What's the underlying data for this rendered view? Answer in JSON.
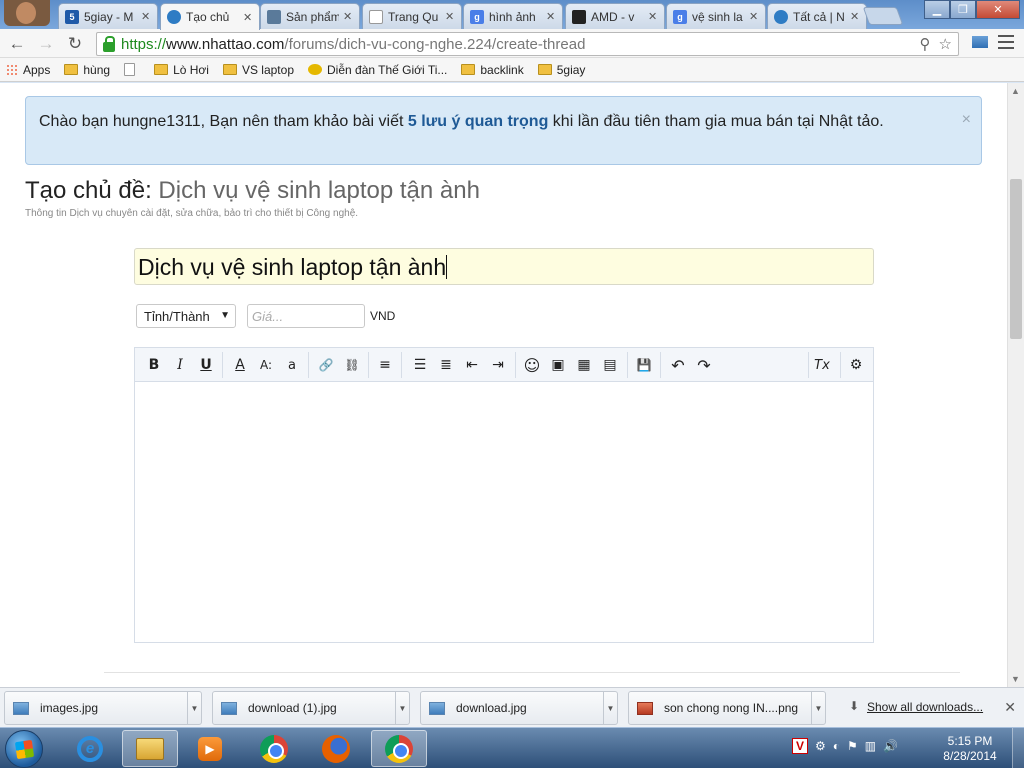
{
  "browser": {
    "tabs": [
      {
        "label": "5giay - M",
        "favicon_text": "5",
        "favicon_color": "#1f5aa8"
      },
      {
        "label": "Tạo chủ",
        "favicon_text": "",
        "favicon_color": "#2e7cc4"
      },
      {
        "label": "Sản phẩm",
        "favicon_text": "",
        "favicon_color": "#5a7a9a"
      },
      {
        "label": "Trang Qu",
        "favicon_text": "",
        "favicon_color": "#ffffff"
      },
      {
        "label": "hình ảnh",
        "favicon_text": "g",
        "favicon_color": "#4a7ee8"
      },
      {
        "label": "AMD - v",
        "favicon_text": "",
        "favicon_color": "#222222"
      },
      {
        "label": "vệ sinh la",
        "favicon_text": "g",
        "favicon_color": "#4a7ee8"
      },
      {
        "label": "Tất cả | N",
        "favicon_text": "",
        "favicon_color": "#2e7cc4"
      }
    ],
    "url_scheme": "https://",
    "url_host": "www.nhattao.com",
    "url_path": "/forums/dich-vu-cong-nghe.224/create-thread",
    "bookmarks": [
      {
        "label": "Apps",
        "kind": "apps"
      },
      {
        "label": "hùng",
        "kind": "folder"
      },
      {
        "label": "",
        "kind": "page"
      },
      {
        "label": "Lò Hơi",
        "kind": "folder"
      },
      {
        "label": "VS laptop",
        "kind": "folder"
      },
      {
        "label": "Diễn đàn Thế Giới Ti...",
        "kind": "flower"
      },
      {
        "label": "backlink",
        "kind": "folder"
      },
      {
        "label": "5giay",
        "kind": "folder"
      }
    ]
  },
  "notice": {
    "before": "Chào bạn hungne1311, Bạn nên tham khảo bài viết ",
    "link": "5 lưu ý quan trọng",
    "after": " khi lần đầu tiên tham gia mua bán tại Nhật tảo.",
    "close": "×"
  },
  "form": {
    "heading_prefix": "Tạo chủ đề:",
    "heading_forum": "Dịch vụ vệ sinh laptop tận ành",
    "description": "Thông tin Dịch vụ chuyên cài đặt, sửa chữa, bảo trì cho thiết bị Công nghệ.",
    "title_value": "Dịch vụ vệ sinh laptop tận ành",
    "province_selected": "Tỉnh/Thành",
    "price_placeholder": "Giá...",
    "currency": "VND"
  },
  "editor": {
    "toolbar": [
      {
        "name": "bold-button",
        "glyph": "B"
      },
      {
        "name": "italic-button",
        "glyph": "I"
      },
      {
        "name": "underline-button",
        "glyph": "U"
      },
      {
        "name": "font-color-button",
        "glyph": "A"
      },
      {
        "name": "font-size-button",
        "glyph": "A:"
      },
      {
        "name": "font-family-button",
        "glyph": "a"
      },
      {
        "name": "link-button",
        "glyph": "🔗"
      },
      {
        "name": "unlink-button",
        "glyph": "⛓"
      },
      {
        "name": "align-button",
        "glyph": "≡"
      },
      {
        "name": "bullet-list-button",
        "glyph": "☰"
      },
      {
        "name": "numbered-list-button",
        "glyph": "≣"
      },
      {
        "name": "outdent-button",
        "glyph": "⇤"
      },
      {
        "name": "indent-button",
        "glyph": "⇥"
      },
      {
        "name": "smilie-button",
        "glyph": "☺"
      },
      {
        "name": "image-button",
        "glyph": "▣"
      },
      {
        "name": "media-button",
        "glyph": "▦"
      },
      {
        "name": "insert-more-button",
        "glyph": "▤"
      },
      {
        "name": "save-draft-button",
        "glyph": "💾"
      },
      {
        "name": "undo-button",
        "glyph": "↶"
      },
      {
        "name": "redo-button",
        "glyph": "↷"
      },
      {
        "name": "remove-format-button",
        "glyph": "Tx"
      },
      {
        "name": "toggle-bbcode-button",
        "glyph": "⚙"
      }
    ]
  },
  "downloads": {
    "items": [
      {
        "label": "images.jpg",
        "icon": "image-file-icon"
      },
      {
        "label": "download (1).jpg",
        "icon": "image-file-icon"
      },
      {
        "label": "download.jpg",
        "icon": "image-file-icon"
      },
      {
        "label": "son chong nong IN....png",
        "icon": "png-file-icon"
      }
    ],
    "show_all": "Show all downloads..."
  },
  "taskbar": {
    "time": "5:15 PM",
    "date": "8/28/2014"
  }
}
